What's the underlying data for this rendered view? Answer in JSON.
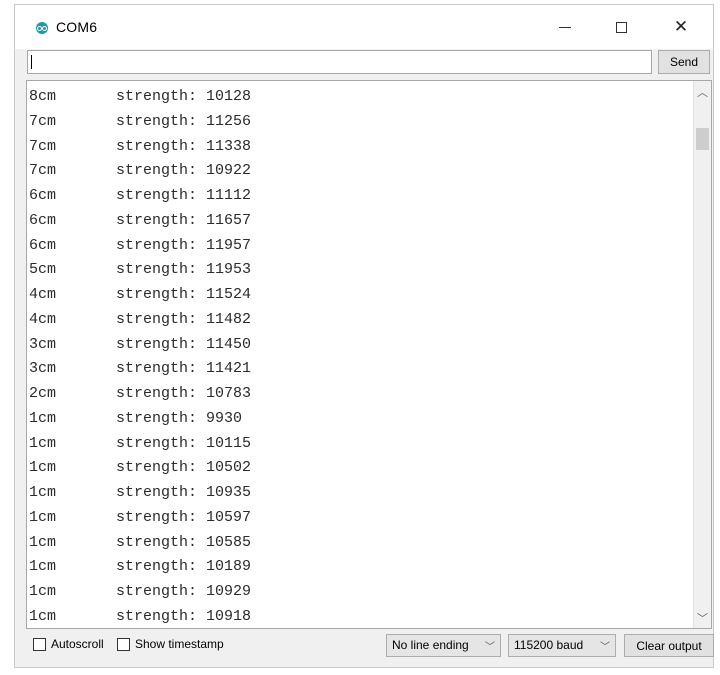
{
  "window": {
    "title": "COM6"
  },
  "input": {
    "value": "",
    "send_label": "Send"
  },
  "output": {
    "lines": [
      {
        "distance": "8cm",
        "strength": "strength: 10128"
      },
      {
        "distance": "7cm",
        "strength": "strength: 11256"
      },
      {
        "distance": "7cm",
        "strength": "strength: 11338"
      },
      {
        "distance": "7cm",
        "strength": "strength: 10922"
      },
      {
        "distance": "6cm",
        "strength": "strength: 11112"
      },
      {
        "distance": "6cm",
        "strength": "strength: 11657"
      },
      {
        "distance": "6cm",
        "strength": "strength: 11957"
      },
      {
        "distance": "5cm",
        "strength": "strength: 11953"
      },
      {
        "distance": "4cm",
        "strength": "strength: 11524"
      },
      {
        "distance": "4cm",
        "strength": "strength: 11482"
      },
      {
        "distance": "3cm",
        "strength": "strength: 11450"
      },
      {
        "distance": "3cm",
        "strength": "strength: 11421"
      },
      {
        "distance": "2cm",
        "strength": "strength: 10783"
      },
      {
        "distance": "1cm",
        "strength": "strength: 9930"
      },
      {
        "distance": "1cm",
        "strength": "strength: 10115"
      },
      {
        "distance": "1cm",
        "strength": "strength: 10502"
      },
      {
        "distance": "1cm",
        "strength": "strength: 10935"
      },
      {
        "distance": "1cm",
        "strength": "strength: 10597"
      },
      {
        "distance": "1cm",
        "strength": "strength: 10585"
      },
      {
        "distance": "1cm",
        "strength": "strength: 10189"
      },
      {
        "distance": "1cm",
        "strength": "strength: 10929"
      },
      {
        "distance": "1cm",
        "strength": "strength: 10918"
      }
    ]
  },
  "status": {
    "autoscroll_label": "Autoscroll",
    "timestamp_label": "Show timestamp",
    "line_ending": "No line ending",
    "baud": "115200 baud",
    "clear_label": "Clear output"
  },
  "colors": {
    "app_icon": "#1f9aa8"
  }
}
